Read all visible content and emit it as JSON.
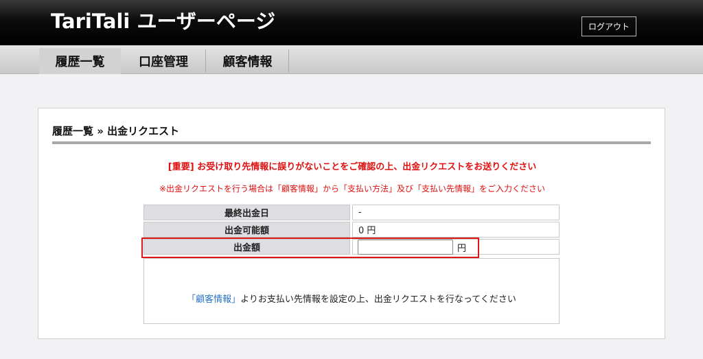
{
  "header": {
    "title": "TariTali ユーザーページ",
    "logout_label": "ログアウト"
  },
  "nav": {
    "tabs": [
      {
        "label": "履歴一覧",
        "active": true
      },
      {
        "label": "口座管理",
        "active": false
      },
      {
        "label": "顧客情報",
        "active": false
      }
    ]
  },
  "breadcrumb": "履歴一覧 » 出金リクエスト",
  "notices": {
    "important": "[重要] お受け取り先情報に誤りがないことをご確認の上、出金リクエストをお送りください",
    "note": "※出金リクエストを行う場合は「顧客情報」から「支払い方法」及び「支払い先情報」をご入力ください"
  },
  "table": {
    "rows": [
      {
        "label": "最終出金日",
        "value": "-"
      },
      {
        "label": "出金可能額",
        "value": "0 円"
      },
      {
        "label": "出金額",
        "value": ""
      }
    ],
    "amount_input_value": "",
    "amount_unit": "円"
  },
  "info": {
    "link_text": "「顧客情報」",
    "text": "よりお支払い先情報を設定の上、出金リクエストを行なってください"
  },
  "colors": {
    "accent_red": "#e01010",
    "link_blue": "#2a74c4",
    "header_bg": "#000000"
  }
}
